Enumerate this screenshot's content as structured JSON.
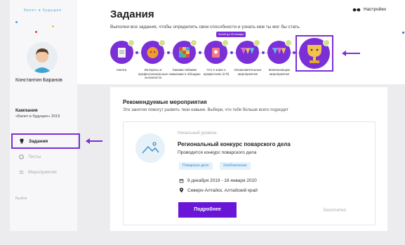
{
  "brand": {
    "logo_text": "билет в будущее",
    "accent": "#7b2fd6"
  },
  "user": {
    "name": "Константин Баранов"
  },
  "campaign": {
    "title": "Кампания",
    "text": "«Билет в будущее» 2019"
  },
  "nav": {
    "items": [
      {
        "label": "Задания",
        "active": true
      },
      {
        "label": "Тесты",
        "active": false
      },
      {
        "label": "Мероприятия",
        "active": false
      }
    ],
    "logout": "Выйти"
  },
  "header": {
    "title": "Задания",
    "subtitle": "Выполни все задания, чтобы определить свои способности и узнать кем ты мог бы стать.",
    "settings": "Настройки"
  },
  "steps": {
    "badge": "Успей до 09 января",
    "items": [
      {
        "label": "Анкета"
      },
      {
        "label": "Интересы и профессиональные склонности"
      },
      {
        "label": "Какими гибкими навыками я обладаю"
      },
      {
        "label": "Что я знаю о профессиях (СП)"
      },
      {
        "label": "Ознакомительные мероприятия"
      },
      {
        "label": "Вовлекающие мероприятия"
      }
    ]
  },
  "recommended": {
    "title": "Рекомендуемые мероприятия",
    "subtitle": "Эти занятия помогут развить твои навыки. Выбери, что тебе больше всего подходит"
  },
  "event": {
    "level": "Начальный уровень",
    "title": "Региональный конкурс поварского дела",
    "description": "Проводится конкурс поварского дела",
    "tags": [
      "Поварское дело",
      "Хлебопечение"
    ],
    "dates": "9 декабря 2019 - 18 января 2020",
    "location": "Северо-Алтайск, Алтайский край",
    "button": "Подробнее",
    "price": "Бесплатно"
  }
}
